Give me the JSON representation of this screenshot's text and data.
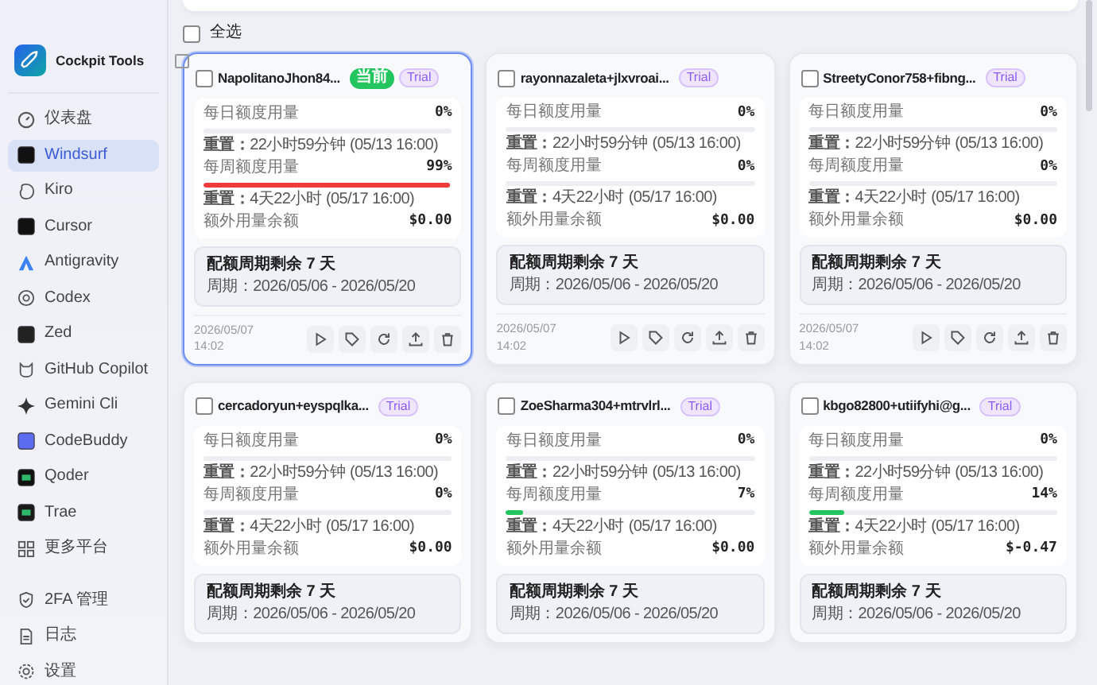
{
  "sidebar": {
    "app_name": "Cockpit Tools",
    "items": [
      {
        "label": "仪表盘",
        "selected": false
      },
      {
        "label": "Windsurf",
        "selected": true
      },
      {
        "label": "Kiro",
        "selected": false
      },
      {
        "label": "Cursor",
        "selected": false
      },
      {
        "label": "Antigravity",
        "selected": false
      },
      {
        "label": "Codex",
        "selected": false
      },
      {
        "label": "Zed",
        "selected": false
      },
      {
        "label": "GitHub Copilot",
        "selected": false
      },
      {
        "label": "Gemini Cli",
        "selected": false
      },
      {
        "label": "CodeBuddy",
        "selected": false
      },
      {
        "label": "Qoder",
        "selected": false
      },
      {
        "label": "Trae",
        "selected": false
      },
      {
        "label": "更多平台",
        "selected": false
      }
    ],
    "bottom_items": [
      {
        "label": "2FA 管理",
        "selected": false
      },
      {
        "label": "日志",
        "selected": false
      },
      {
        "label": "设置",
        "selected": false
      }
    ]
  },
  "select_all": {
    "label": "全选",
    "checked": false
  },
  "cards": [
    {
      "name": "NapolitanoJhon84...",
      "selected": true,
      "checked": false,
      "badges": [
        {
          "label": "当前",
          "kind": "current"
        },
        {
          "label": "Trial",
          "kind": "plan"
        }
      ],
      "quotas": [
        {
          "label": "每日额度用量",
          "value": "0%",
          "level": 0,
          "reset_label": "重置：",
          "reset": "22小时59分钟",
          "reset_time": "(05/13 16:00)"
        },
        {
          "label": "每周额度用量",
          "value": "99%",
          "level": 0.99,
          "reset_label": "重置：",
          "reset": "4天22小时",
          "reset_time": "(05/17 16:00)"
        }
      ],
      "extra": {
        "label": "额外用量余额",
        "value": "$0.00"
      },
      "cycle": {
        "title": "配额周期剩余 7 天",
        "period": "周期：2026/05/06 - 2026/05/20"
      },
      "date": "2026/05/07",
      "time": "14:02"
    },
    {
      "name": "rayonnazaleta+jlxvroai...",
      "selected": false,
      "checked": false,
      "badges": [
        {
          "label": "Trial",
          "kind": "plan"
        }
      ],
      "quotas": [
        {
          "label": "每日额度用量",
          "value": "0%",
          "level": 0,
          "reset_label": "重置：",
          "reset": "22小时59分钟",
          "reset_time": "(05/13 16:00)"
        },
        {
          "label": "每周额度用量",
          "value": "0%",
          "level": 0,
          "reset_label": "重置：",
          "reset": "4天22小时",
          "reset_time": "(05/17 16:00)"
        }
      ],
      "extra": {
        "label": "额外用量余额",
        "value": "$0.00"
      },
      "cycle": {
        "title": "配额周期剩余 7 天",
        "period": "周期：2026/05/06 - 2026/05/20"
      },
      "date": "2026/05/07",
      "time": "14:02"
    },
    {
      "name": "StreetyConor758+fibng...",
      "selected": false,
      "checked": false,
      "badges": [
        {
          "label": "Trial",
          "kind": "plan"
        }
      ],
      "quotas": [
        {
          "label": "每日额度用量",
          "value": "0%",
          "level": 0,
          "reset_label": "重置：",
          "reset": "22小时59分钟",
          "reset_time": "(05/13 16:00)"
        },
        {
          "label": "每周额度用量",
          "value": "0%",
          "level": 0,
          "reset_label": "重置：",
          "reset": "4天22小时",
          "reset_time": "(05/17 16:00)"
        }
      ],
      "extra": {
        "label": "额外用量余额",
        "value": "$0.00"
      },
      "cycle": {
        "title": "配额周期剩余 7 天",
        "period": "周期：2026/05/06 - 2026/05/20"
      },
      "date": "2026/05/07",
      "time": "14:02"
    },
    {
      "name": "cercadoryun+eyspqlka...",
      "selected": false,
      "checked": false,
      "badges": [
        {
          "label": "Trial",
          "kind": "plan"
        }
      ],
      "quotas": [
        {
          "label": "每日额度用量",
          "value": "0%",
          "level": 0,
          "reset_label": "重置：",
          "reset": "22小时59分钟",
          "reset_time": "(05/13 16:00)"
        },
        {
          "label": "每周额度用量",
          "value": "0%",
          "level": 0,
          "reset_label": "重置：",
          "reset": "4天22小时",
          "reset_time": "(05/17 16:00)"
        }
      ],
      "extra": {
        "label": "额外用量余额",
        "value": "$0.00"
      },
      "cycle": {
        "title": "配额周期剩余 7 天",
        "period": "周期：2026/05/06 - 2026/05/20"
      }
    },
    {
      "name": "ZoeSharma304+mtrvlrl...",
      "selected": false,
      "checked": false,
      "badges": [
        {
          "label": "Trial",
          "kind": "plan"
        }
      ],
      "quotas": [
        {
          "label": "每日额度用量",
          "value": "0%",
          "level": 0,
          "reset_label": "重置：",
          "reset": "22小时59分钟",
          "reset_time": "(05/13 16:00)"
        },
        {
          "label": "每周额度用量",
          "value": "7%",
          "level": 0.07,
          "reset_label": "重置：",
          "reset": "4天22小时",
          "reset_time": "(05/17 16:00)"
        }
      ],
      "extra": {
        "label": "额外用量余额",
        "value": "$0.00"
      },
      "cycle": {
        "title": "配额周期剩余 7 天",
        "period": "周期：2026/05/06 - 2026/05/20"
      }
    },
    {
      "name": "kbgo82800+utiifyhi@g...",
      "selected": false,
      "checked": false,
      "badges": [
        {
          "label": "Trial",
          "kind": "plan"
        }
      ],
      "quotas": [
        {
          "label": "每日额度用量",
          "value": "0%",
          "level": 0,
          "reset_label": "重置：",
          "reset": "22小时59分钟",
          "reset_time": "(05/13 16:00)"
        },
        {
          "label": "每周额度用量",
          "value": "14%",
          "level": 0.14,
          "reset_label": "重置：",
          "reset": "4天22小时",
          "reset_time": "(05/17 16:00)"
        }
      ],
      "extra": {
        "label": "额外用量余额",
        "value": "$-0.47"
      },
      "cycle": {
        "title": "配额周期剩余 7 天",
        "period": "周期：2026/05/06 - 2026/05/20"
      }
    }
  ]
}
